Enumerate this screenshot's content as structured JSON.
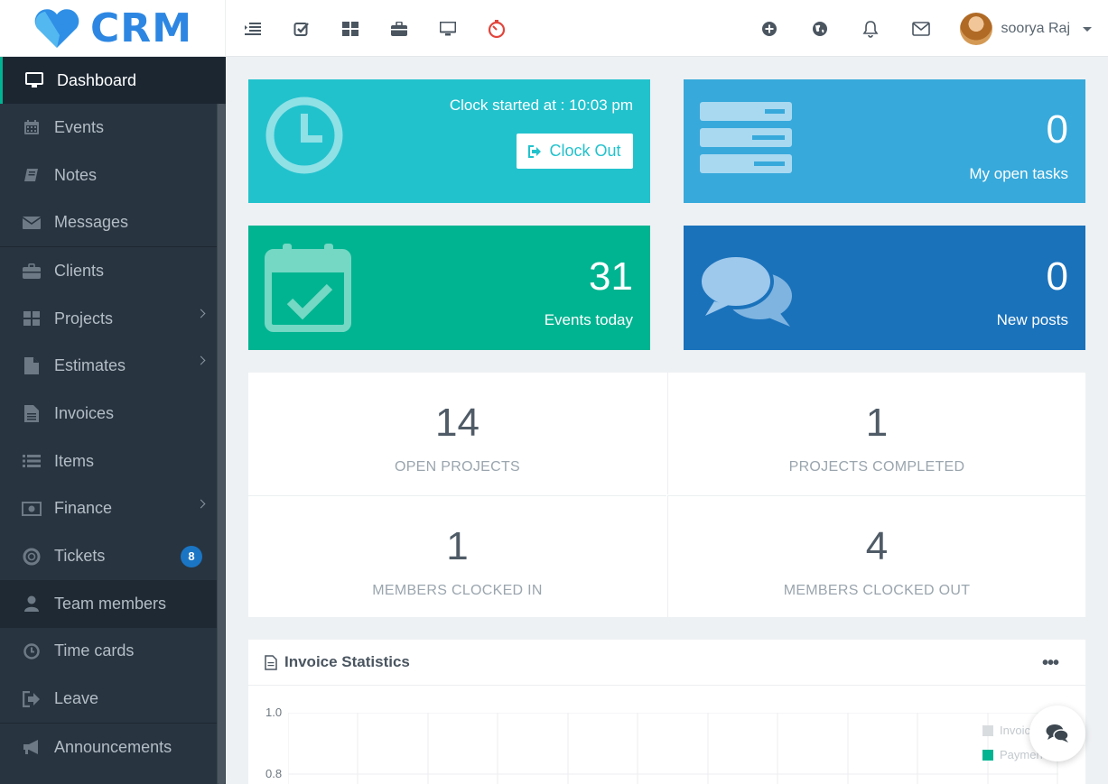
{
  "app": {
    "logo_text": "CRM",
    "brand_color": "#2d87e2"
  },
  "topbar": {
    "left_icons": [
      "indent-icon",
      "check-square-icon",
      "grid-icon",
      "briefcase-icon",
      "desktop-icon",
      "timer-icon"
    ],
    "right_icons": [
      "plus-circle-icon",
      "globe-icon",
      "bell-icon",
      "envelope-icon"
    ],
    "user_name": "soorya Raj"
  },
  "sidebar": {
    "items": [
      {
        "label": "Dashboard",
        "icon": "desktop-icon",
        "active": true
      },
      {
        "label": "Events",
        "icon": "calendar-icon"
      },
      {
        "label": "Notes",
        "icon": "book-icon"
      },
      {
        "label": "Messages",
        "icon": "envelope-icon"
      },
      {
        "label": "Clients",
        "icon": "briefcase-icon"
      },
      {
        "label": "Projects",
        "icon": "grid-icon",
        "has_submenu": true
      },
      {
        "label": "Estimates",
        "icon": "file-icon",
        "has_submenu": true
      },
      {
        "label": "Invoices",
        "icon": "file-text-icon"
      },
      {
        "label": "Items",
        "icon": "list-icon"
      },
      {
        "label": "Finance",
        "icon": "money-icon",
        "has_submenu": true
      },
      {
        "label": "Tickets",
        "icon": "lifebuoy-icon",
        "badge": "8"
      },
      {
        "label": "Team members",
        "icon": "user-icon"
      },
      {
        "label": "Time cards",
        "icon": "clock-icon"
      },
      {
        "label": "Leave",
        "icon": "sign-out-icon"
      },
      {
        "label": "Announcements",
        "icon": "bullhorn-icon"
      }
    ]
  },
  "widgets": {
    "clock": {
      "text": "Clock started at : 10:03 pm",
      "button_label": "Clock Out",
      "color": "#22c2cd"
    },
    "tasks": {
      "value": "0",
      "label": "My open tasks",
      "color": "#37a9db"
    },
    "events": {
      "value": "31",
      "label": "Events today",
      "color": "#00b491"
    },
    "posts": {
      "value": "0",
      "label": "New posts",
      "color": "#1a72bb"
    }
  },
  "stats": [
    {
      "value": "14",
      "label": "OPEN PROJECTS"
    },
    {
      "value": "1",
      "label": "PROJECTS COMPLETED"
    },
    {
      "value": "1",
      "label": "MEMBERS CLOCKED IN"
    },
    {
      "value": "4",
      "label": "MEMBERS CLOCKED OUT"
    }
  ],
  "invoice_stats": {
    "title": "Invoice Statistics",
    "menu_label": "•••",
    "y_ticks": [
      "1.0",
      "0.8"
    ],
    "legend": [
      {
        "label": "Invoic",
        "color": "#d9dcdf"
      },
      {
        "label": "Paymen",
        "color": "#00b491"
      }
    ]
  }
}
